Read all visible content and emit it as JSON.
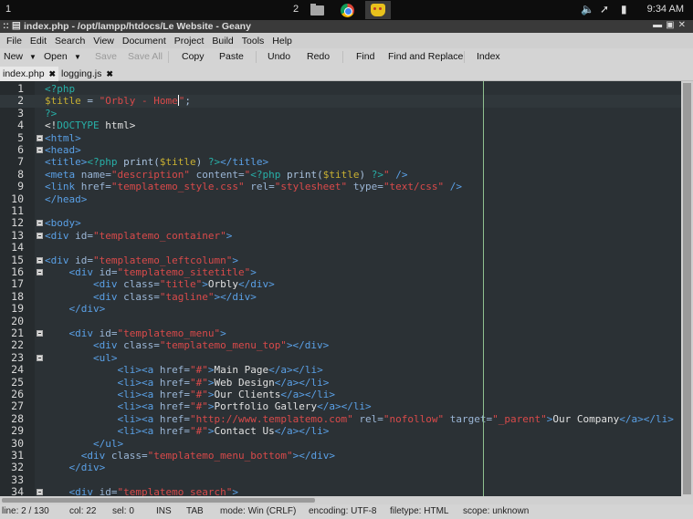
{
  "panel": {
    "workspace_left": "1",
    "workspace_right": "2",
    "launchers": [
      "file-manager",
      "chrome-browser",
      "geany"
    ],
    "tray": [
      "volume",
      "network",
      "battery"
    ],
    "clock": "9:34 AM"
  },
  "window": {
    "title": "index.php - /opt/lampp/htdocs/Le Website - Geany",
    "controls": [
      "minimize",
      "maximize",
      "close"
    ]
  },
  "menubar": [
    "File",
    "Edit",
    "Search",
    "View",
    "Document",
    "Project",
    "Build",
    "Tools",
    "Help"
  ],
  "toolbar": {
    "new": "New",
    "open": "Open",
    "save": "Save",
    "save_all": "Save All",
    "copy": "Copy",
    "paste": "Paste",
    "undo": "Undo",
    "redo": "Redo",
    "find": "Find",
    "find_replace": "Find and Replace",
    "index": "Index"
  },
  "tabs": [
    {
      "label": "index.php",
      "active": true
    },
    {
      "label": "logging.js",
      "active": false
    }
  ],
  "editor": {
    "current_line": 2,
    "lines": [
      {
        "n": "1",
        "fold": false,
        "html": "<span class='p'>&lt;?php</span>"
      },
      {
        "n": "2",
        "fold": false,
        "html": "<span class='v'>$title</span> <span class='f'>=</span> <span class='s'>\"Orbly - Home</span><span class='caret'></span><span class='s'>\"</span><span class='f'>;</span>"
      },
      {
        "n": "3",
        "fold": false,
        "html": "<span class='p'>?&gt;</span>"
      },
      {
        "n": "4",
        "fold": false,
        "html": "&lt;!<span class='d'>DOCTYPE</span> html&gt;"
      },
      {
        "n": "5",
        "fold": true,
        "html": "<span class='t'>&lt;html&gt;</span>"
      },
      {
        "n": "6",
        "fold": true,
        "html": "<span class='t'>&lt;head&gt;</span>"
      },
      {
        "n": "7",
        "fold": false,
        "html": "<span class='t'>&lt;title&gt;</span><span class='p'>&lt;?php</span> <span class='f'>print(</span><span class='v'>$title</span><span class='f'>)</span> <span class='p'>?&gt;</span><span class='t'>&lt;/title&gt;</span>"
      },
      {
        "n": "8",
        "fold": false,
        "html": "<span class='t'>&lt;meta</span> <span class='a'>name=</span><span class='s'>\"description\"</span> <span class='a'>content=</span><span class='s'>\"</span><span class='p'>&lt;?php</span> <span class='f'>print(</span><span class='v'>$title</span><span class='f'>)</span> <span class='p'>?&gt;</span><span class='s'>\"</span> <span class='t'>/&gt;</span>"
      },
      {
        "n": "9",
        "fold": false,
        "html": "<span class='t'>&lt;link</span> <span class='a'>href=</span><span class='s'>\"templatemo_style.css\"</span> <span class='a'>rel=</span><span class='s'>\"stylesheet\"</span> <span class='a'>type=</span><span class='s'>\"text/css\"</span> <span class='t'>/&gt;</span>"
      },
      {
        "n": "10",
        "fold": false,
        "html": "<span class='t'>&lt;/head&gt;</span>"
      },
      {
        "n": "11",
        "fold": false,
        "html": ""
      },
      {
        "n": "12",
        "fold": true,
        "html": "<span class='t'>&lt;body&gt;</span>"
      },
      {
        "n": "13",
        "fold": true,
        "html": "<span class='t'>&lt;div</span> <span class='a'>id=</span><span class='s'>\"templatemo_container\"</span><span class='t'>&gt;</span>"
      },
      {
        "n": "14",
        "fold": false,
        "html": ""
      },
      {
        "n": "15",
        "fold": true,
        "html": "<span class='t'>&lt;div</span> <span class='a'>id=</span><span class='s'>\"templatemo_leftcolumn\"</span><span class='t'>&gt;</span>"
      },
      {
        "n": "16",
        "fold": true,
        "html": "    <span class='t'>&lt;div</span> <span class='a'>id=</span><span class='s'>\"templatemo_sitetitle\"</span><span class='t'>&gt;</span>"
      },
      {
        "n": "17",
        "fold": false,
        "html": "        <span class='t'>&lt;div</span> <span class='a'>class=</span><span class='s'>\"title\"</span><span class='t'>&gt;</span>Orbly<span class='t'>&lt;/div&gt;</span>"
      },
      {
        "n": "18",
        "fold": false,
        "html": "        <span class='t'>&lt;div</span> <span class='a'>class=</span><span class='s'>\"tagline\"</span><span class='t'>&gt;&lt;/div&gt;</span>"
      },
      {
        "n": "19",
        "fold": false,
        "html": "    <span class='t'>&lt;/div&gt;</span>"
      },
      {
        "n": "20",
        "fold": false,
        "html": ""
      },
      {
        "n": "21",
        "fold": true,
        "html": "    <span class='t'>&lt;div</span> <span class='a'>id=</span><span class='s'>\"templatemo_menu\"</span><span class='t'>&gt;</span>"
      },
      {
        "n": "22",
        "fold": false,
        "html": "        <span class='t'>&lt;div</span> <span class='a'>class=</span><span class='s'>\"templatemo_menu_top\"</span><span class='t'>&gt;&lt;/div&gt;</span>"
      },
      {
        "n": "23",
        "fold": true,
        "html": "        <span class='t'>&lt;ul&gt;</span>"
      },
      {
        "n": "24",
        "fold": false,
        "html": "            <span class='t'>&lt;li&gt;&lt;a</span> <span class='a'>href=</span><span class='s'>\"#\"</span><span class='t'>&gt;</span>Main Page<span class='t'>&lt;/a&gt;&lt;/li&gt;</span>"
      },
      {
        "n": "25",
        "fold": false,
        "html": "            <span class='t'>&lt;li&gt;&lt;a</span> <span class='a'>href=</span><span class='s'>\"#\"</span><span class='t'>&gt;</span>Web Design<span class='t'>&lt;/a&gt;&lt;/li&gt;</span>"
      },
      {
        "n": "26",
        "fold": false,
        "html": "            <span class='t'>&lt;li&gt;&lt;a</span> <span class='a'>href=</span><span class='s'>\"#\"</span><span class='t'>&gt;</span>Our Clients<span class='t'>&lt;/a&gt;&lt;/li&gt;</span>"
      },
      {
        "n": "27",
        "fold": false,
        "html": "            <span class='t'>&lt;li&gt;&lt;a</span> <span class='a'>href=</span><span class='s'>\"#\"</span><span class='t'>&gt;</span>Portfolio Gallery<span class='t'>&lt;/a&gt;&lt;/li&gt;</span>"
      },
      {
        "n": "28",
        "fold": false,
        "html": "            <span class='t'>&lt;li&gt;&lt;a</span> <span class='a'>href=</span><span class='s'>\"http://www.templatemo.com\"</span> <span class='a'>rel=</span><span class='s'>\"nofollow\"</span> <span class='a'>target=</span><span class='s'>\"_parent\"</span><span class='t'>&gt;</span>Our Company<span class='t'>&lt;/a&gt;&lt;/li&gt;</span>"
      },
      {
        "n": "29",
        "fold": false,
        "html": "            <span class='t'>&lt;li&gt;&lt;a</span> <span class='a'>href=</span><span class='s'>\"#\"</span><span class='t'>&gt;</span>Contact Us<span class='t'>&lt;/a&gt;&lt;/li&gt;</span>"
      },
      {
        "n": "30",
        "fold": false,
        "html": "        <span class='t'>&lt;/ul&gt;</span>"
      },
      {
        "n": "31",
        "fold": false,
        "html": "      <span class='t'>&lt;div</span> <span class='a'>class=</span><span class='s'>\"templatemo_menu_bottom\"</span><span class='t'>&gt;&lt;/div&gt;</span>"
      },
      {
        "n": "32",
        "fold": false,
        "html": "    <span class='t'>&lt;/div&gt;</span>"
      },
      {
        "n": "33",
        "fold": false,
        "html": ""
      },
      {
        "n": "34",
        "fold": true,
        "html": "    <span class='t'>&lt;div</span> <span class='a'>id=</span><span class='s'>\"templatemo_search\"</span><span class='t'>&gt;</span>"
      }
    ]
  },
  "statusbar": {
    "line": "line: 2 / 130",
    "col": "col: 22",
    "sel": "sel: 0",
    "ins": "INS",
    "tab": "TAB",
    "mode": "mode: Win (CRLF)",
    "encoding": "encoding: UTF-8",
    "filetype": "filetype: HTML",
    "scope": "scope: unknown"
  }
}
